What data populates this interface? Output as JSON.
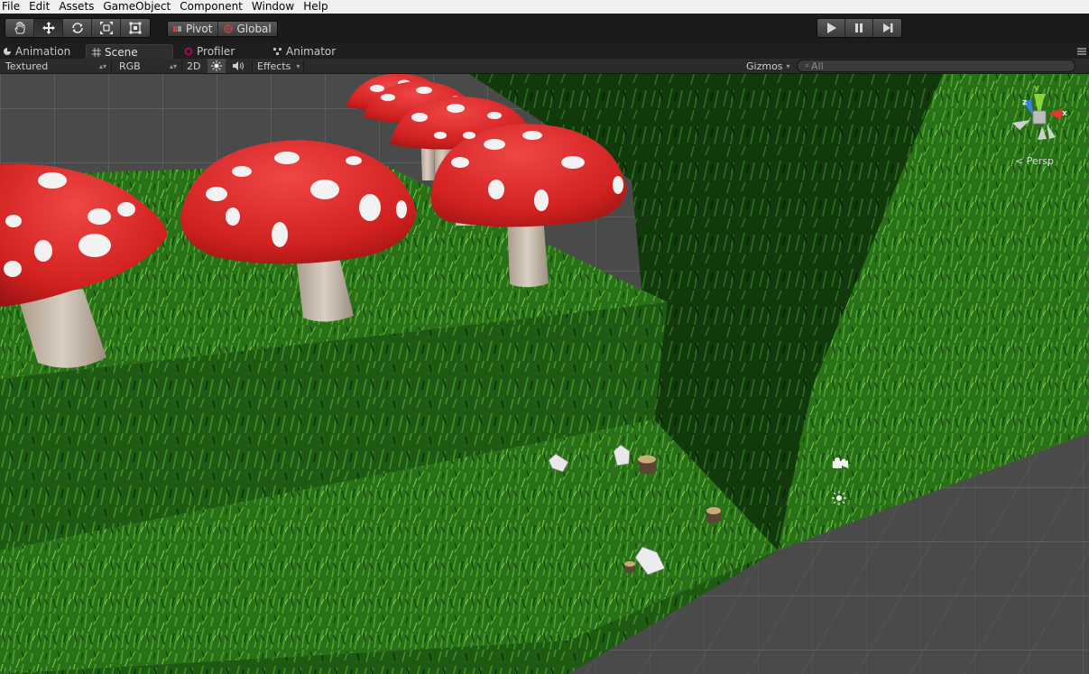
{
  "menu": {
    "items": [
      "File",
      "Edit",
      "Assets",
      "GameObject",
      "Component",
      "Window",
      "Help"
    ]
  },
  "toolbar": {
    "transform_tools": [
      "hand-tool",
      "move-tool",
      "rotate-tool",
      "scale-tool",
      "rect-tool"
    ],
    "pivot_label": "Pivot",
    "global_label": "Global",
    "playback": [
      "play",
      "pause",
      "step"
    ]
  },
  "tabs": [
    {
      "label": "Animation",
      "icon": "animation-icon"
    },
    {
      "label": "Scene",
      "icon": "scene-grid-icon",
      "active": true
    },
    {
      "label": "Profiler",
      "icon": "profiler-icon"
    },
    {
      "label": "Animator",
      "icon": "animator-icon"
    }
  ],
  "scene_toolbar": {
    "shading_mode": "Textured",
    "render_mode": "RGB",
    "mode_2d": "2D",
    "effects_label": "Effects",
    "gizmos_label": "Gizmos",
    "search_placeholder": "All"
  },
  "gizmo": {
    "axes": {
      "y": "y",
      "x": "x",
      "z": "z"
    },
    "projection_label": "Persp"
  },
  "colors": {
    "mushroom_cap": "#d42626",
    "mushroom_spot": "#f2f2f2",
    "mushroom_stem": "#cfc3b3",
    "grass_top": "#2f7d1f",
    "grass_dark": "#123f0c",
    "axis_x": "#e23a2a",
    "axis_y": "#8ad33c",
    "axis_z": "#3a7ee0"
  }
}
